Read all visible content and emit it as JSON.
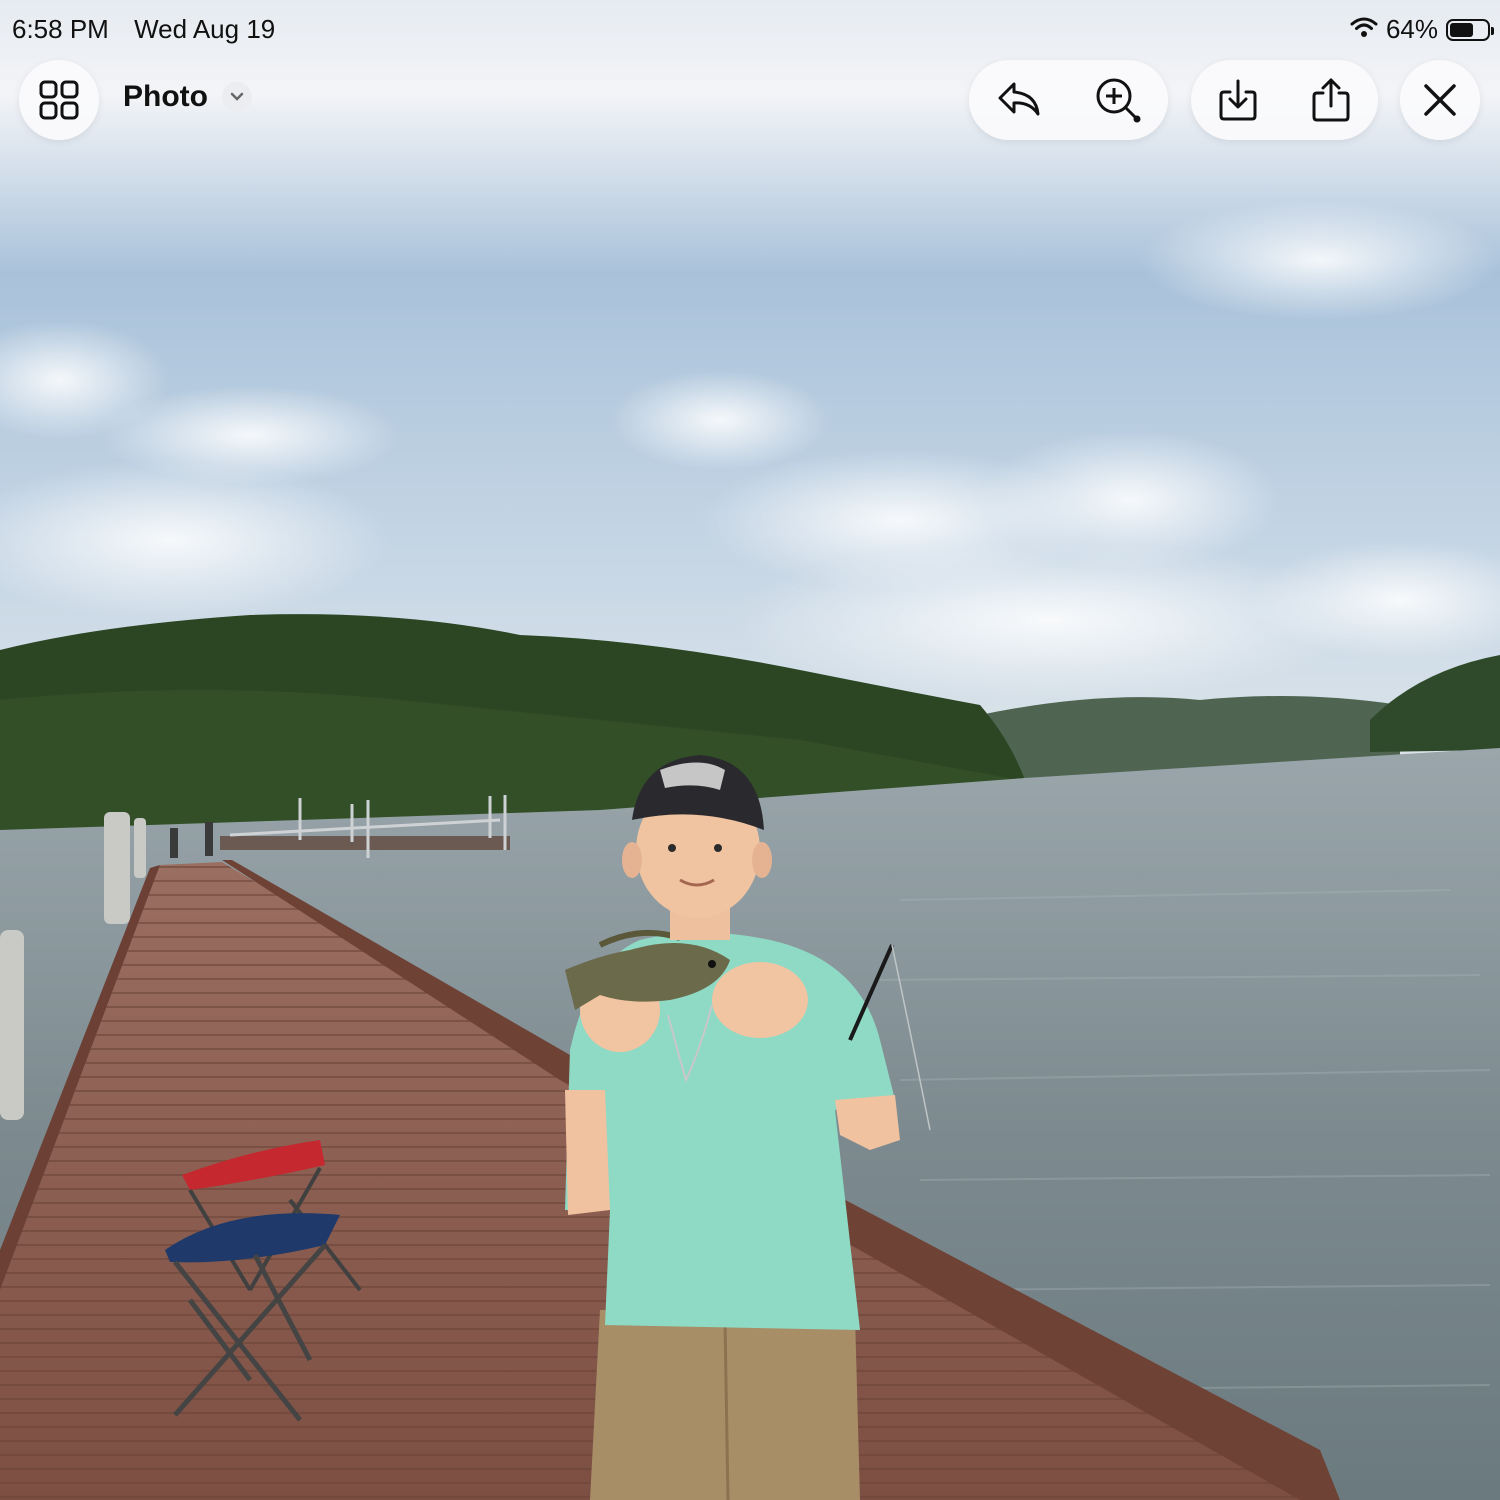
{
  "status_bar": {
    "time": "6:58 PM",
    "date": "Wed Aug 19",
    "battery_percent_text": "64%",
    "battery_level": 0.64,
    "wifi_icon": "wifi-icon",
    "battery_icon": "battery-icon"
  },
  "toolbar": {
    "title": "Photo",
    "grid_icon": "grid-icon",
    "title_menu_icon": "chevron-down-icon",
    "reply_icon": "reply-icon",
    "zoom_icon": "zoom-in-icon",
    "save_icon": "download-icon",
    "share_icon": "share-icon",
    "close_icon": "close-icon"
  },
  "colors": {
    "sky_top": "#dfe6ee",
    "sky_mid": "#b7ccdf",
    "water": "#7f8d92",
    "trees": "#2f4a26",
    "dock": "#8a5a4c",
    "shirt": "#8fd8c4",
    "shorts": "#a98f68",
    "toolbar_pill": "#f8f8fa"
  }
}
